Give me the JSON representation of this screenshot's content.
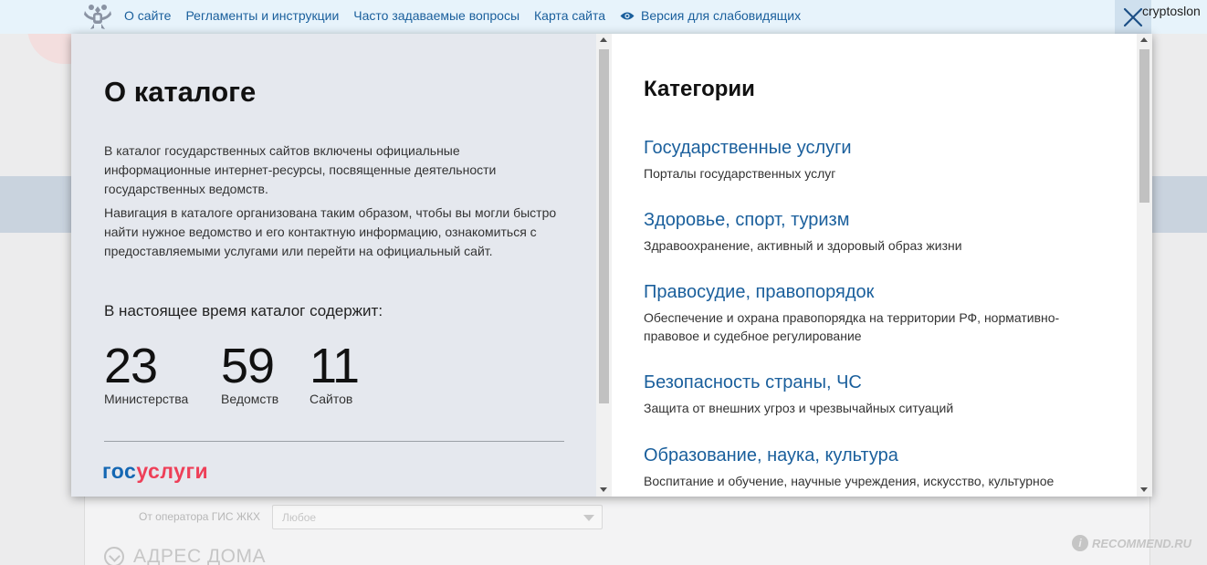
{
  "nav": {
    "items": [
      "О сайте",
      "Регламенты и инструкции",
      "Часто задаваемые вопросы",
      "Карта сайта"
    ],
    "accessibility_label": "Версия для слабовидящих",
    "username": "cryptoslon"
  },
  "catalog": {
    "title": "О каталоге",
    "paragraph1": "В каталог государственных сайтов включены официальные информационные интернет-ресурсы, посвященные деятельности государственных ведомств.",
    "paragraph2": "Навигация в каталоге организована таким образом, чтобы вы могли быстро найти нужное ведомство и его контактную информацию, ознакомиться с предоставляемыми услугами или перейти на официальный сайт.",
    "count_heading": "В настоящее время каталог содержит:",
    "stats": [
      {
        "value": "23",
        "label": "Министерства"
      },
      {
        "value": "59",
        "label": "Ведомств"
      },
      {
        "value": "11",
        "label": "Сайтов"
      }
    ],
    "logo_part1": "гос",
    "logo_part2": "услуги"
  },
  "categories": {
    "title": "Категории",
    "items": [
      {
        "title": "Государственные услуги",
        "desc": "Порталы государственных услуг"
      },
      {
        "title": "Здоровье, спорт, туризм",
        "desc": "Здравоохранение, активный и здоровый образ жизни"
      },
      {
        "title": "Правосудие, правопорядок",
        "desc": "Обеспечение и охрана правопорядка на территории РФ, нормативно-правовое и судебное регулирование"
      },
      {
        "title": "Безопасность страны, ЧС",
        "desc": "Защита от внешних угроз и чрезвычайных ситуаций"
      },
      {
        "title": "Образование, наука, культура",
        "desc": "Воспитание и обучение, научные учреждения, искусство, культурное"
      }
    ]
  },
  "background": {
    "filter_label": "От оператора ГИС ЖКХ",
    "filter_value": "Любое",
    "section_heading": "АДРЕС ДОМА",
    "watermark": "RECOMMEND.RU",
    "watermark_icon": "i"
  },
  "colors": {
    "link": "#1a5f9c",
    "gos": "#1467b3",
    "uslugi": "#ee3f58",
    "left_panel_bg": "#e5e8ee",
    "topbar_bg": "#e7f3fb"
  }
}
